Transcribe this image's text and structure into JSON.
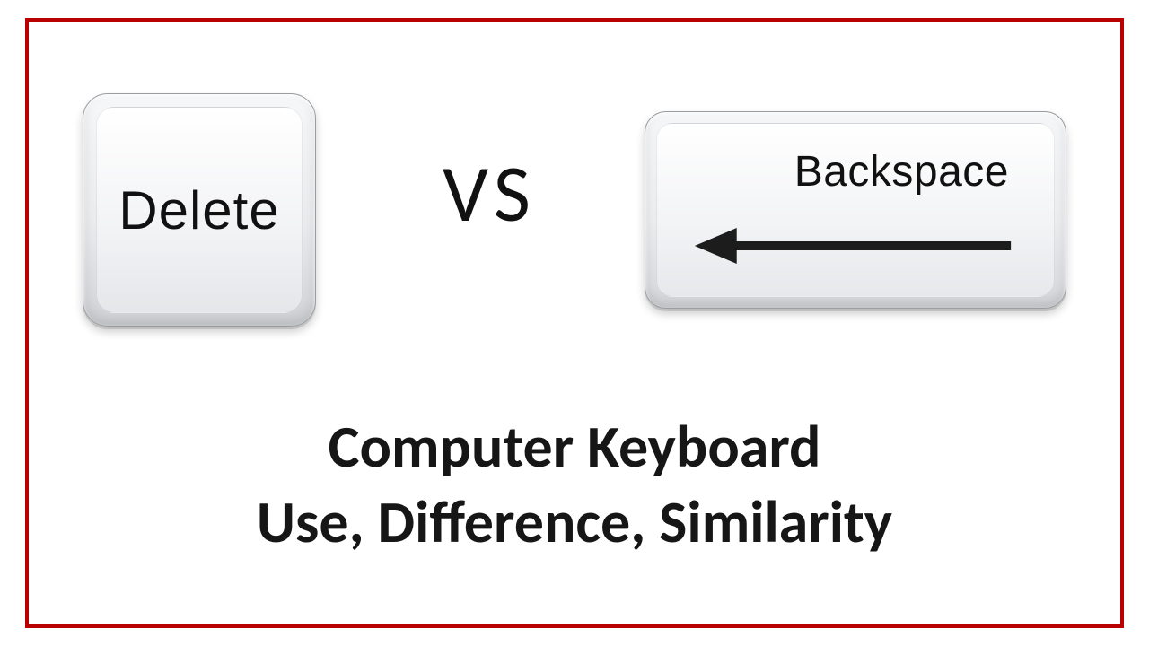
{
  "frame": {
    "border_color": "#b90000"
  },
  "keys": {
    "delete_label": "Delete",
    "backspace_label": "Backspace",
    "vs_label": "VS",
    "arrow_icon": "arrow-left-icon"
  },
  "caption": {
    "line1": "Computer Keyboard",
    "line2": "Use, Difference, Similarity"
  }
}
